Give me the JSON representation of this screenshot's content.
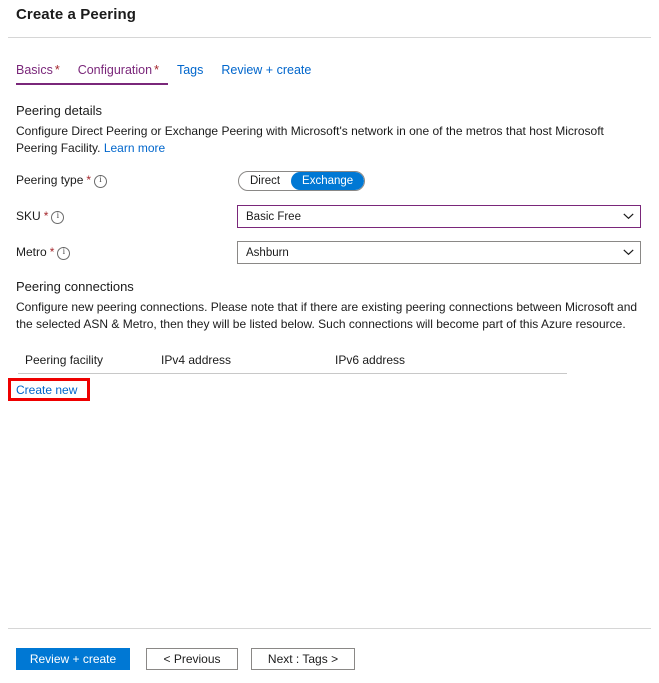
{
  "header": {
    "title": "Create a Peering"
  },
  "tabs": [
    {
      "label": "Basics",
      "required": "*",
      "state": "visited",
      "active": false
    },
    {
      "label": "Configuration",
      "required": "*",
      "state": "visited",
      "active": true
    },
    {
      "label": "Tags",
      "required": "",
      "state": "link",
      "active": false
    },
    {
      "label": "Review + create",
      "required": "",
      "state": "link",
      "active": false
    }
  ],
  "peering_details": {
    "section_title": "Peering details",
    "description": "Configure Direct Peering or Exchange Peering with Microsoft's network in one of the metros that host Microsoft Peering Facility.",
    "learn_more": "Learn more",
    "peering_type": {
      "label": "Peering type",
      "required": "*",
      "info_icon": "info-circle-icon",
      "options": [
        "Direct",
        "Exchange"
      ],
      "selected": "Exchange"
    },
    "sku": {
      "label": "SKU",
      "required": "*",
      "info_icon": "info-circle-icon",
      "value": "Basic Free",
      "chevron_icon": "chevron-down-icon"
    },
    "metro": {
      "label": "Metro",
      "required": "*",
      "info_icon": "info-circle-icon",
      "value": "Ashburn",
      "chevron_icon": "chevron-down-icon"
    }
  },
  "peering_connections": {
    "section_title": "Peering connections",
    "description": "Configure new peering connections. Please note that if there are existing peering connections between Microsoft and the selected ASN & Metro, then they will be listed below. Such connections will become part of this Azure resource.",
    "columns": [
      "Peering facility",
      "IPv4 address",
      "IPv6 address"
    ],
    "rows": [],
    "create_new": "Create new"
  },
  "footer": {
    "review_create": "Review + create",
    "previous": "< Previous",
    "next": "Next : Tags >"
  },
  "colors": {
    "accent_blue": "#0078d4",
    "link_blue": "#0066cc",
    "visited_purple": "#7a277a",
    "required_red": "#a4262c",
    "highlight_red": "#ee0000"
  }
}
